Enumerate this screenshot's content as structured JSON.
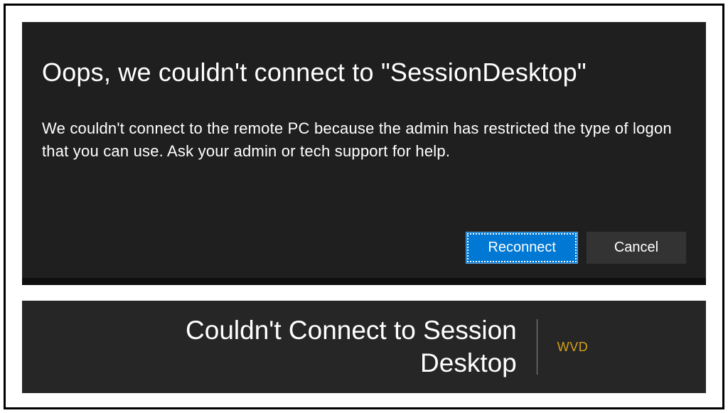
{
  "dialog": {
    "title": "Oops, we couldn't connect to \"SessionDesktop\"",
    "message": "We couldn't connect to the remote PC because the admin has restricted the type of logon that you can use. Ask your admin or tech support for help.",
    "reconnect_label": "Reconnect",
    "cancel_label": "Cancel"
  },
  "caption": {
    "title": "Couldn't Connect to Session Desktop",
    "tag": "WVD"
  }
}
